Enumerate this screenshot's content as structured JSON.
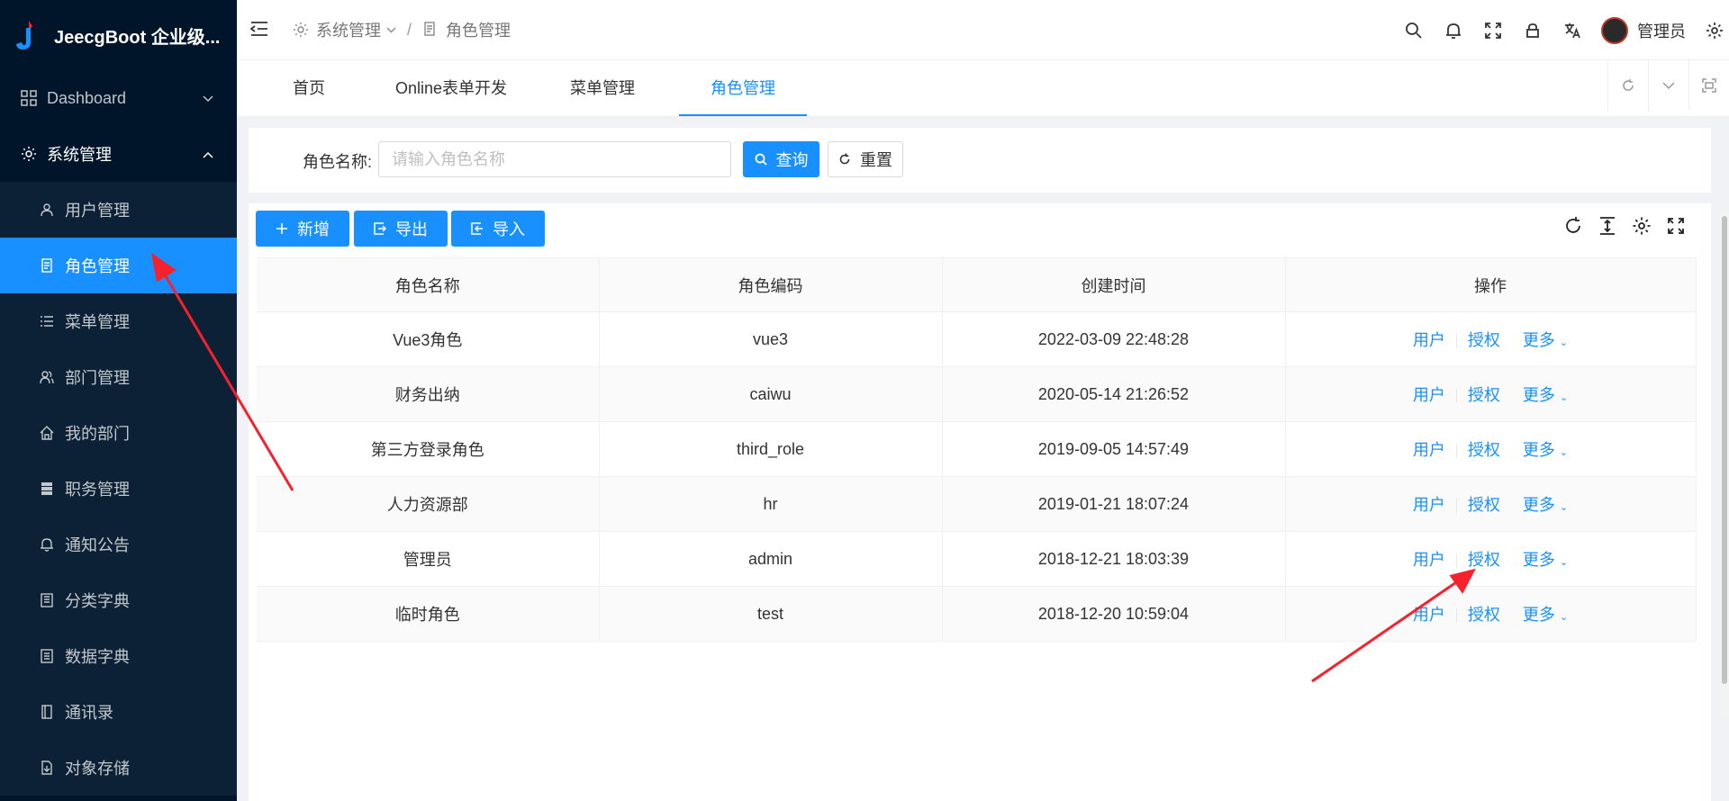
{
  "app": {
    "title": "JeecgBoot 企业级..."
  },
  "sidebar": {
    "items": [
      {
        "label": "Dashboard",
        "icon": "dashboard-icon"
      },
      {
        "label": "系统管理",
        "icon": "gear-icon"
      }
    ],
    "sub_items": [
      {
        "label": "用户管理",
        "icon": "user-icon"
      },
      {
        "label": "角色管理",
        "icon": "document-icon"
      },
      {
        "label": "菜单管理",
        "icon": "list-icon"
      },
      {
        "label": "部门管理",
        "icon": "team-icon"
      },
      {
        "label": "我的部门",
        "icon": "home-icon"
      },
      {
        "label": "职务管理",
        "icon": "database-icon"
      },
      {
        "label": "通知公告",
        "icon": "bell-icon"
      },
      {
        "label": "分类字典",
        "icon": "book-icon"
      },
      {
        "label": "数据字典",
        "icon": "dictionary-icon"
      },
      {
        "label": "通讯录",
        "icon": "contacts-icon"
      },
      {
        "label": "对象存储",
        "icon": "storage-icon"
      }
    ]
  },
  "header": {
    "breadcrumb": [
      "系统管理",
      "角色管理"
    ],
    "user_name": "管理员"
  },
  "tabs": [
    "首页",
    "Online表单开发",
    "菜单管理",
    "角色管理"
  ],
  "search": {
    "label": "角色名称:",
    "placeholder": "请输入角色名称",
    "value": "",
    "query_label": "查询",
    "reset_label": "重置"
  },
  "toolbar": {
    "add_label": "新增",
    "export_label": "导出",
    "import_label": "导入"
  },
  "table": {
    "columns": [
      "角色名称",
      "角色编码",
      "创建时间",
      "操作"
    ],
    "rows": [
      {
        "name": "Vue3角色",
        "code": "vue3",
        "created": "2022-03-09 22:48:28"
      },
      {
        "name": "财务出纳",
        "code": "caiwu",
        "created": "2020-05-14 21:26:52"
      },
      {
        "name": "第三方登录角色",
        "code": "third_role",
        "created": "2019-09-05 14:57:49"
      },
      {
        "name": "人力资源部",
        "code": "hr",
        "created": "2019-01-21 18:07:24"
      },
      {
        "name": "管理员",
        "code": "admin",
        "created": "2018-12-21 18:03:39"
      },
      {
        "name": "临时角色",
        "code": "test",
        "created": "2018-12-20 10:59:04"
      }
    ],
    "actions": {
      "user": "用户",
      "auth": "授权",
      "more": "更多"
    }
  },
  "colors": {
    "sidebar_bg": "#001529",
    "accent": "#1890ff",
    "annotation_arrow": "#f5222d"
  }
}
